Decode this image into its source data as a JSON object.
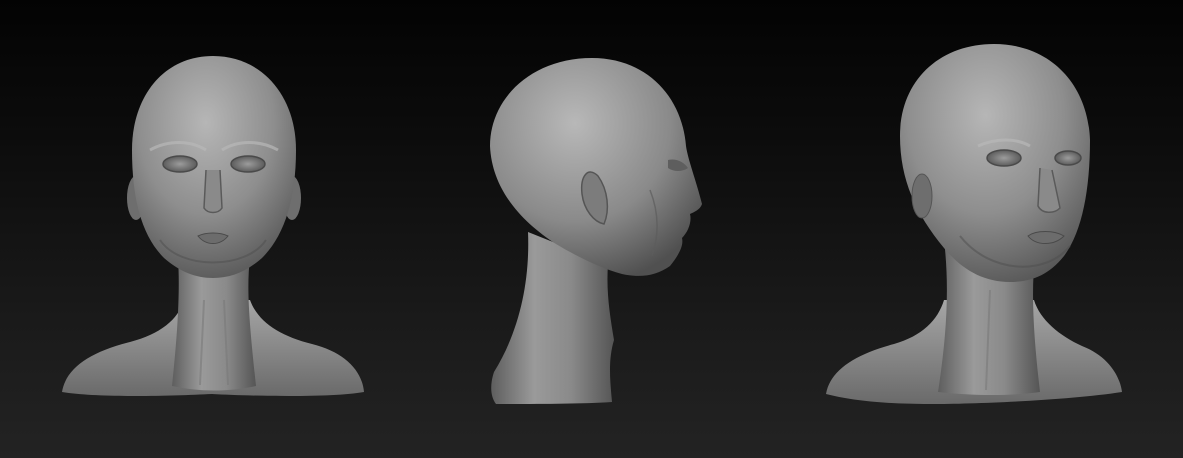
{
  "scene": {
    "background_top": "#030303",
    "background_bottom": "#232323",
    "clay_color": "#8c8c8c",
    "clay_highlight": "#b4b4b4",
    "clay_shadow": "#3a3a3a"
  },
  "views": [
    {
      "id": "front",
      "icon": "sculpt-bust-front"
    },
    {
      "id": "side",
      "icon": "sculpt-bust-profile"
    },
    {
      "id": "three-quarter",
      "icon": "sculpt-bust-three-quarter"
    }
  ]
}
